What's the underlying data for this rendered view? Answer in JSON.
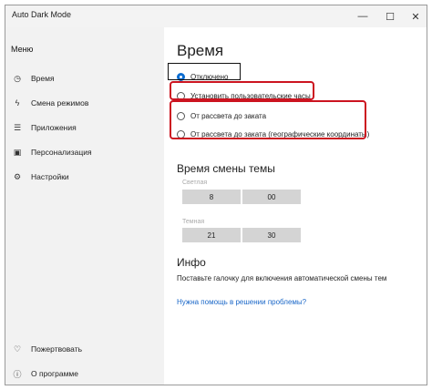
{
  "window": {
    "title": "Auto Dark Mode",
    "controls": {
      "minimize": "—",
      "maximize": "☐",
      "close": "✕"
    }
  },
  "sidebar": {
    "menu_label": "Меню",
    "items": [
      {
        "label": "Время",
        "icon": "clock-icon",
        "glyph": "◷"
      },
      {
        "label": "Смена режимов",
        "icon": "lightning-icon",
        "glyph": "ϟ"
      },
      {
        "label": "Приложения",
        "icon": "apps-icon",
        "glyph": "☰"
      },
      {
        "label": "Персонализация",
        "icon": "personalize-icon",
        "glyph": "▣"
      },
      {
        "label": "Настройки",
        "icon": "gear-icon",
        "glyph": "⚙"
      }
    ],
    "bottom_items": [
      {
        "label": "Пожертвовать",
        "icon": "heart-icon",
        "glyph": "♡"
      },
      {
        "label": "О программе",
        "icon": "info-icon",
        "glyph": "ⓘ"
      }
    ]
  },
  "main": {
    "title": "Время",
    "options": [
      {
        "label": "Отключено",
        "selected": true
      },
      {
        "label": "Установить пользовательские часы",
        "selected": false
      },
      {
        "label": "От рассвета до заката",
        "selected": false
      },
      {
        "label": "От рассвета до заката (географические координаты)",
        "selected": false
      }
    ],
    "theme_time": {
      "heading": "Время смены темы",
      "light_label": "Светлая",
      "light_hours": "8",
      "light_minutes": "00",
      "dark_label": "Темная",
      "dark_hours": "21",
      "dark_minutes": "30"
    },
    "info": {
      "heading": "Инфо",
      "text": "Поставьте галочку для включения автоматической смены тем",
      "link": "Нужна помощь в решении проблемы?"
    }
  },
  "colors": {
    "accent": "#0b6cd0",
    "highlight_red": "#cc1420",
    "link": "#1a67c8"
  }
}
